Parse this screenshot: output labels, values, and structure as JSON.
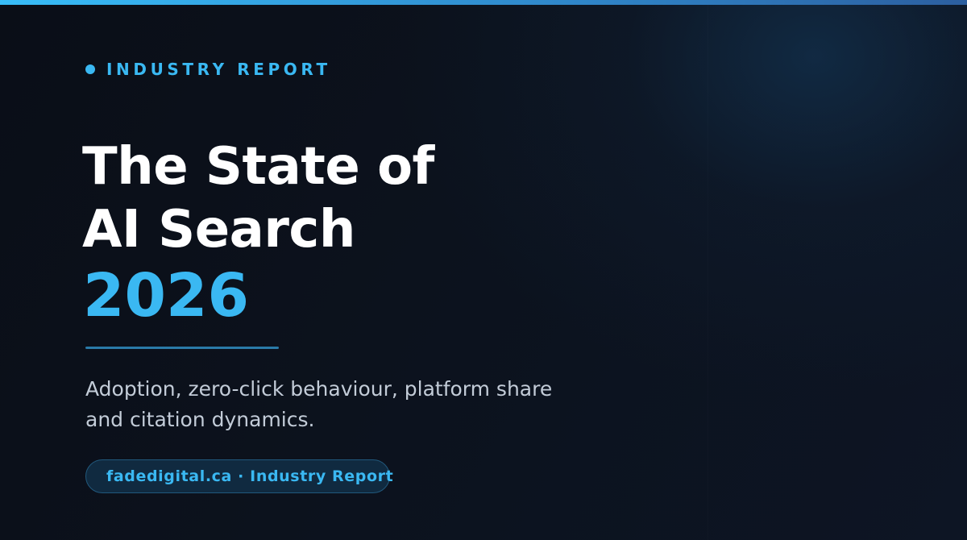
{
  "eyebrow": {
    "label": "INDUSTRY REPORT"
  },
  "title": {
    "line1": "The State of",
    "line2": "AI Search",
    "year": "2026"
  },
  "subtitle": {
    "line1": "Adoption, zero-click behaviour, platform share",
    "line2": "and citation dynamics."
  },
  "pill": {
    "text": "fadedigital.ca · Industry Report"
  },
  "colors": {
    "accent": "#3ab8f2",
    "background": "#0b101b",
    "title": "#ffffff",
    "subtitle": "#c3ccd8"
  }
}
